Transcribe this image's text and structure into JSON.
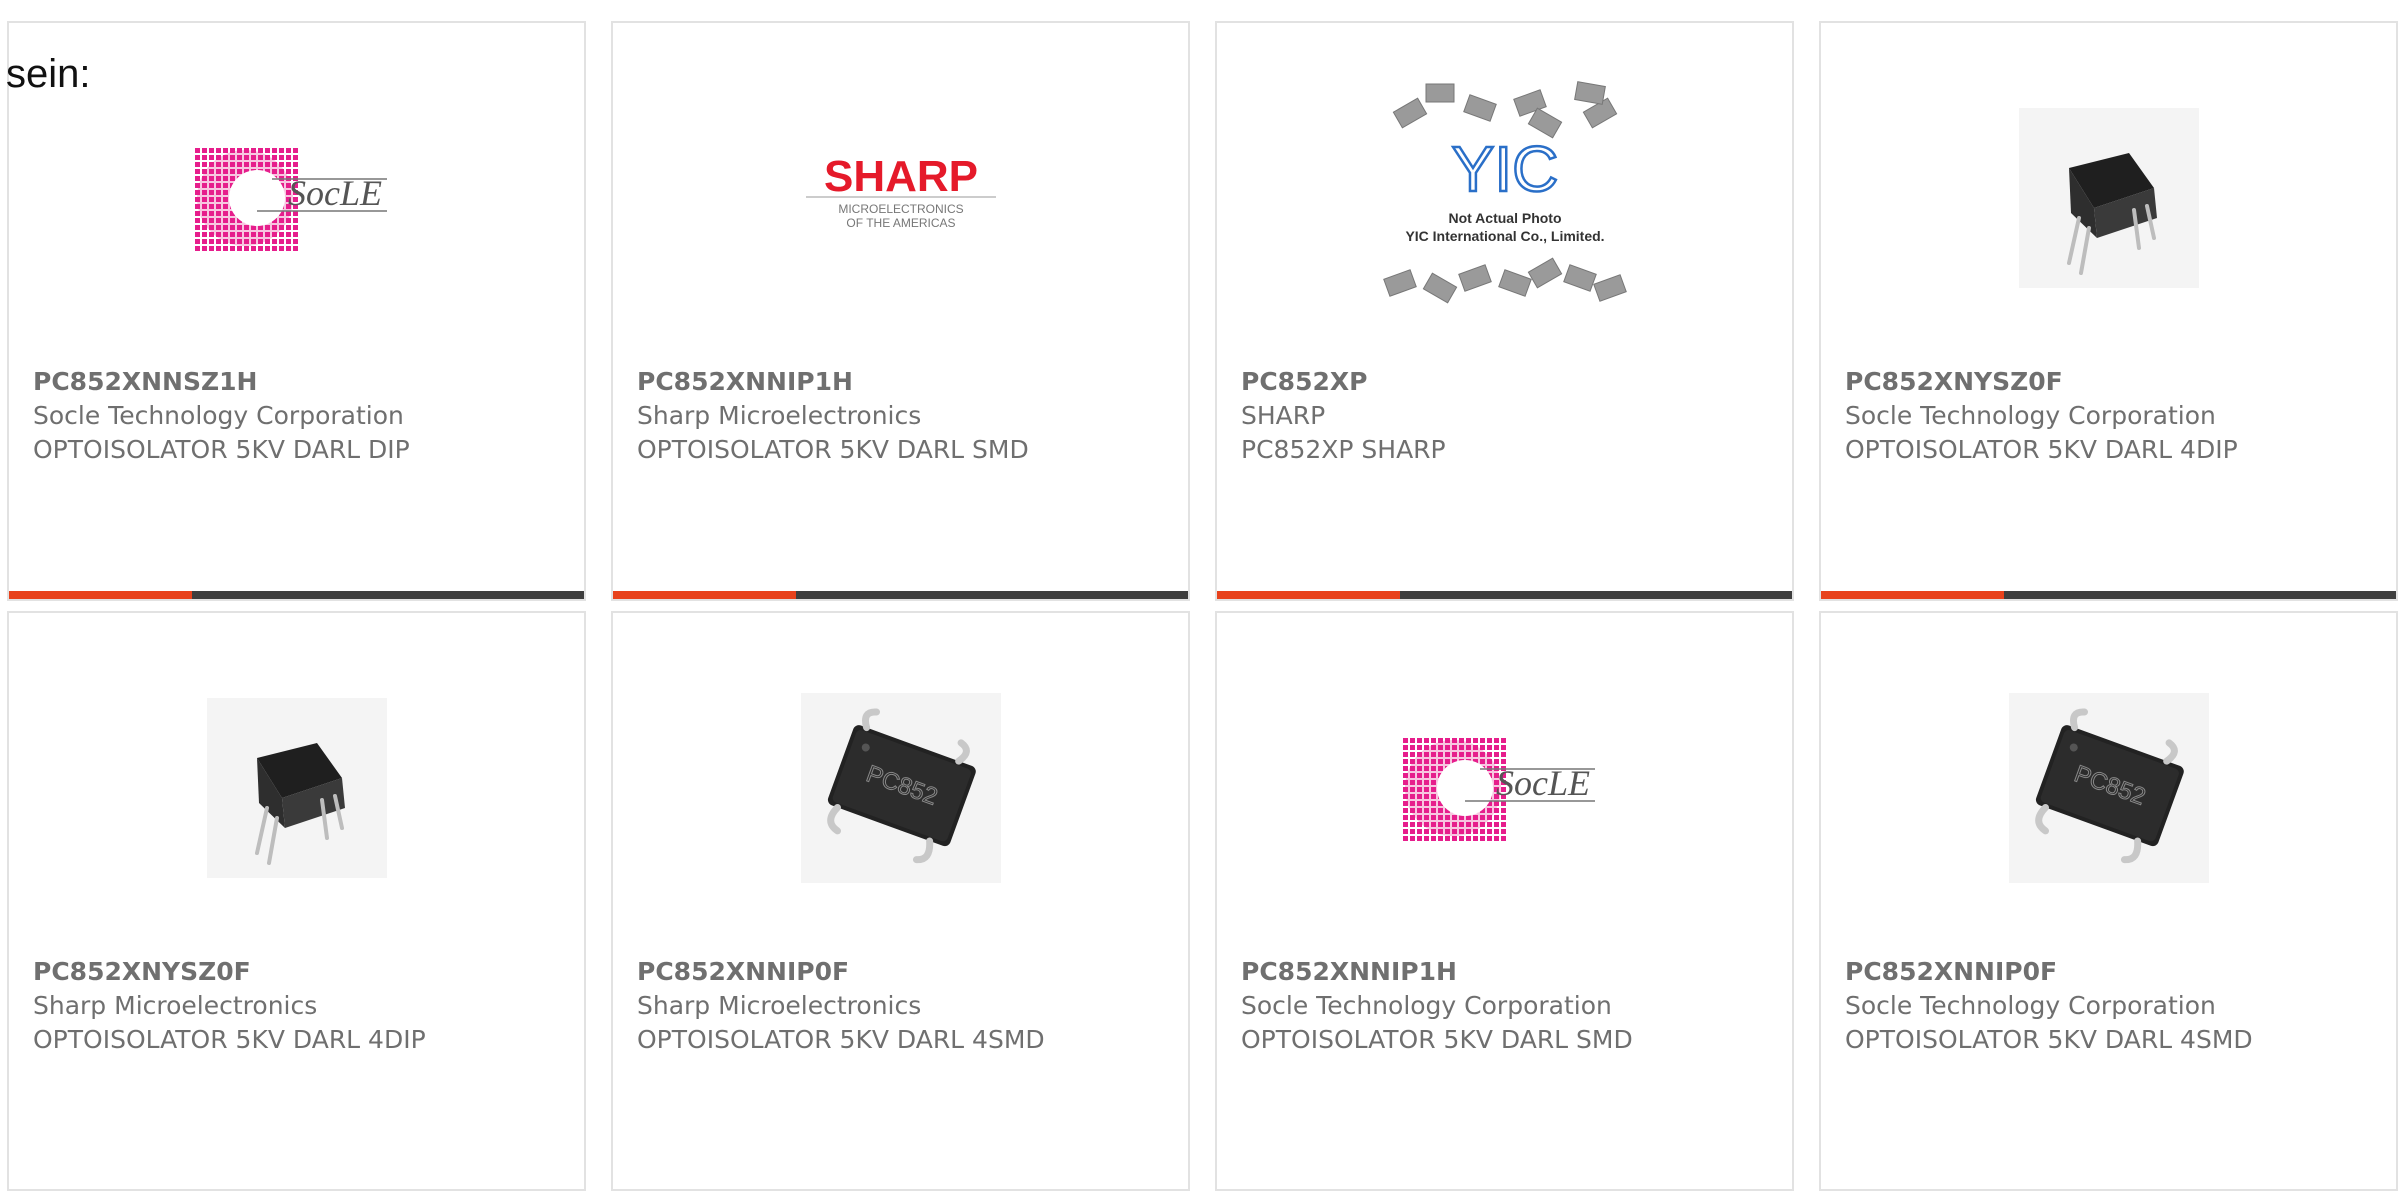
{
  "intro_text": "sein:",
  "colors": {
    "accent": "#e8421c",
    "bar_rest": "#3e3e3e",
    "text": "#6f6f6f",
    "border": "#e2e2e2"
  },
  "products": [
    {
      "part": "PC852XNNSZ1H",
      "manufacturer": "Socle Technology Corporation",
      "description": "OPTOISOLATOR 5KV DARL DIP",
      "image": "socle-logo",
      "image_caption": "SocLE"
    },
    {
      "part": "PC852XNNIP1H",
      "manufacturer": "Sharp Microelectronics",
      "description": "OPTOISOLATOR 5KV DARL SMD",
      "image": "sharp-logo",
      "image_caption": "SHARP",
      "image_subcaption": [
        "MICROELECTRONICS",
        "OF THE AMERICAS"
      ]
    },
    {
      "part": "PC852XP",
      "manufacturer": "SHARP",
      "description": "PC852XP SHARP",
      "image": "yic-placeholder",
      "image_caption": "YIC",
      "image_subcaption": [
        "Not Actual Photo",
        "YIC International Co., Limited."
      ]
    },
    {
      "part": "PC852XNYSZ0F",
      "manufacturer": "Socle Technology Corporation",
      "description": "OPTOISOLATOR 5KV DARL 4DIP",
      "image": "dip-chip"
    },
    {
      "part": "PC852XNYSZ0F",
      "manufacturer": "Sharp Microelectronics",
      "description": "OPTOISOLATOR 5KV DARL 4DIP",
      "image": "dip-chip"
    },
    {
      "part": "PC852XNNIP0F",
      "manufacturer": "Sharp Microelectronics",
      "description": "OPTOISOLATOR 5KV DARL 4SMD",
      "image": "smd-chip",
      "image_caption": "PC852"
    },
    {
      "part": "PC852XNNIP1H",
      "manufacturer": "Socle Technology Corporation",
      "description": "OPTOISOLATOR 5KV DARL SMD",
      "image": "socle-logo",
      "image_caption": "SocLE"
    },
    {
      "part": "PC852XNNIP0F",
      "manufacturer": "Socle Technology Corporation",
      "description": "OPTOISOLATOR 5KV DARL 4SMD",
      "image": "smd-chip",
      "image_caption": "PC852"
    }
  ]
}
